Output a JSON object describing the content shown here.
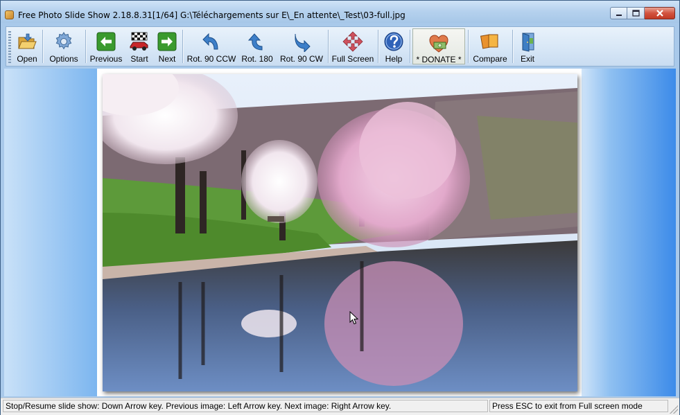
{
  "window": {
    "title": "Free Photo Slide Show 2.18.8.31[1/64] G:\\Téléchargements sur E\\_En attente\\_Test\\03-full.jpg",
    "minimize_glyph": "0",
    "maximize_glyph": "1",
    "close_glyph": "r"
  },
  "toolbar": {
    "open": "Open",
    "options": "Options",
    "previous": "Previous",
    "start": "Start",
    "next": "Next",
    "rot_ccw": "Rot. 90 CCW",
    "rot_180": "Rot. 180",
    "rot_cw": "Rot. 90 CW",
    "full_screen": "Full Screen",
    "help": "Help",
    "donate": "* DONATE *",
    "compare": "Compare",
    "exit": "Exit"
  },
  "status": {
    "left": "Stop/Resume slide show: Down Arrow key. Previous image: Left Arrow key. Next image: Right Arrow key.",
    "right": "Press ESC to exit from Full screen mode"
  },
  "icons": {
    "open": "folder-open-icon",
    "options": "gear-icon",
    "previous": "arrow-left-icon",
    "start": "race-car-flag-icon",
    "next": "arrow-right-icon",
    "rot_ccw": "rotate-ccw-icon",
    "rot_180": "rotate-180-icon",
    "rot_cw": "rotate-cw-icon",
    "full_screen": "fullscreen-arrows-icon",
    "help": "help-question-icon",
    "donate": "heart-money-icon",
    "compare": "compare-icon",
    "exit": "exit-door-icon"
  },
  "colors": {
    "green_button": "#3a9a2e",
    "rotate_blue": "#3d7fc9",
    "fullscreen_red": "#d0525e",
    "help_blue": "#2f62b8"
  }
}
